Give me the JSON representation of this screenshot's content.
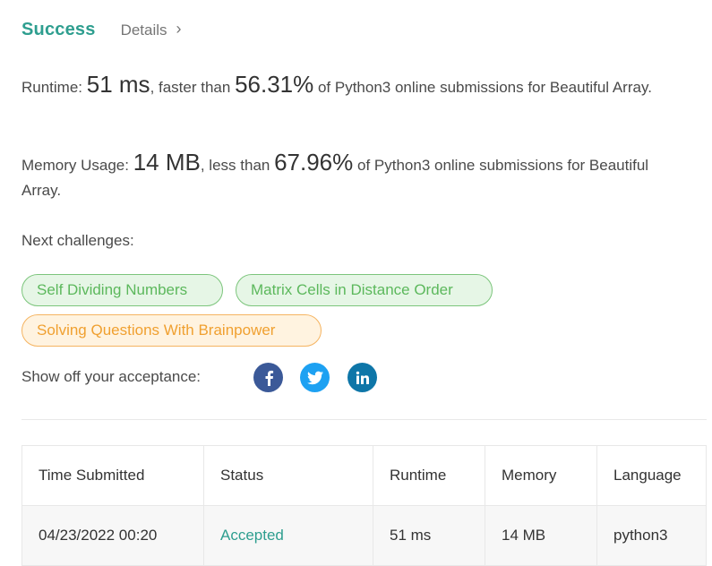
{
  "header": {
    "status": "Success",
    "details_label": "Details",
    "chevron": "›"
  },
  "runtime": {
    "label": "Runtime: ",
    "value": "51 ms",
    "mid": ", faster than ",
    "percent": "56.31%",
    "tail": " of Python3 online submissions for Beautiful Array."
  },
  "memory": {
    "label": "Memory Usage: ",
    "value": "14 MB",
    "mid": ", less than ",
    "percent": "67.96%",
    "tail": " of Python3 online submissions for Beautiful Array."
  },
  "next_challenges": {
    "label": "Next challenges:",
    "items": [
      {
        "label": "Self Dividing Numbers",
        "difficulty_color": "#5cb85c"
      },
      {
        "label": "Matrix Cells in Distance Order",
        "difficulty_color": "#5cb85c"
      },
      {
        "label": "Solving Questions With Brainpower",
        "difficulty_color": "#f0a030"
      }
    ]
  },
  "share": {
    "label": "Show off your acceptance:",
    "icons": [
      "facebook-icon",
      "twitter-icon",
      "linkedin-icon"
    ]
  },
  "table": {
    "headers": [
      "Time Submitted",
      "Status",
      "Runtime",
      "Memory",
      "Language"
    ],
    "rows": [
      {
        "time": "04/23/2022 00:20",
        "status": "Accepted",
        "runtime": "51 ms",
        "memory": "14 MB",
        "language": "python3"
      }
    ]
  },
  "colors": {
    "accent": "#2e9e8f",
    "easy": "#5cb85c",
    "medium": "#f0a030",
    "facebook": "#3b5998",
    "twitter": "#1da1f2",
    "linkedin": "#0e76a8"
  }
}
